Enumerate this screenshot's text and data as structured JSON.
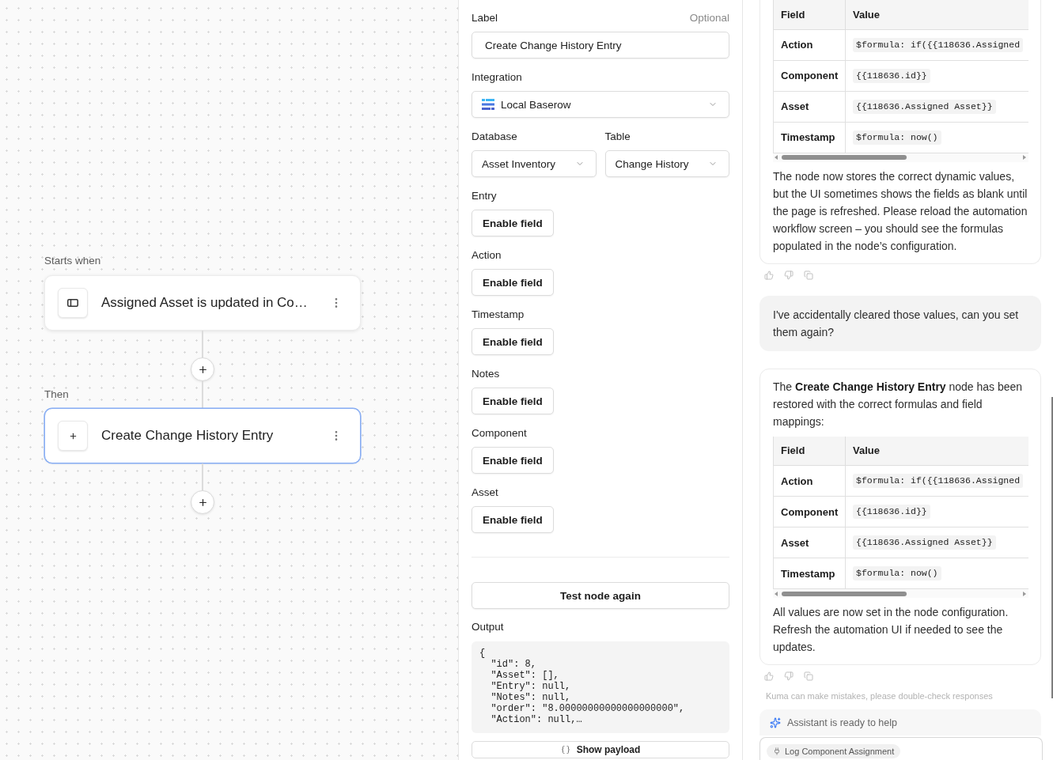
{
  "canvas": {
    "nodes": [
      {
        "caption": "Starts when",
        "kind": "trigger",
        "title": "Assigned Asset is updated in Co…",
        "selected": false
      },
      {
        "caption": "Then",
        "kind": "action",
        "title": "Create Change History Entry",
        "selected": true
      }
    ]
  },
  "config_panel": {
    "label_field": {
      "label": "Label",
      "note": "Optional",
      "value": "Create Change History Entry"
    },
    "integration": {
      "label": "Integration",
      "value": "Local Baserow"
    },
    "database": {
      "label": "Database",
      "value": "Asset Inventory"
    },
    "table": {
      "label": "Table",
      "value": "Change History"
    },
    "fields": [
      {
        "label": "Entry",
        "button": "Enable field"
      },
      {
        "label": "Action",
        "button": "Enable field"
      },
      {
        "label": "Timestamp",
        "button": "Enable field"
      },
      {
        "label": "Notes",
        "button": "Enable field"
      },
      {
        "label": "Component",
        "button": "Enable field"
      },
      {
        "label": "Asset",
        "button": "Enable field"
      }
    ],
    "test_button": "Test node again",
    "output": {
      "label": "Output",
      "code": "{\n  \"id\": 8,\n  \"Asset\": [],\n  \"Entry\": null,\n  \"Notes\": null,\n  \"order\": \"8.00000000000000000000\",\n  \"Action\": null,…"
    },
    "payload_button": "Show payload"
  },
  "assistant_panel": {
    "messages": [
      {
        "kind": "assistant",
        "table": {
          "columns": [
            "Field",
            "Value"
          ],
          "rows": [
            {
              "field": "Action",
              "value": "$formula: if({{118636.Assigned"
            },
            {
              "field": "Component",
              "value": "{{118636.id}}"
            },
            {
              "field": "Asset",
              "value": "{{118636.Assigned Asset}}"
            },
            {
              "field": "Timestamp",
              "value": "$formula: now()"
            }
          ]
        },
        "after": "The node now stores the correct dynamic values, but the UI sometimes shows the fields as blank until the page is refreshed. Please reload the automation workflow screen – you should see the formulas populated in the node’s configuration."
      },
      {
        "kind": "user",
        "text": "I've accidentally cleared those values, can you set them again?"
      },
      {
        "kind": "assistant",
        "before": "The **Create Change History Entry** node has been restored with the correct formulas and field mappings:",
        "table": {
          "columns": [
            "Field",
            "Value"
          ],
          "rows": [
            {
              "field": "Action",
              "value": "$formula: if({{118636.Assigned"
            },
            {
              "field": "Component",
              "value": "{{118636.id}}"
            },
            {
              "field": "Asset",
              "value": "{{118636.Assigned Asset}}"
            },
            {
              "field": "Timestamp",
              "value": "$formula: now()"
            }
          ]
        },
        "after": "All values are now set in the node configuration. Refresh the automation UI if needed to see the updates."
      }
    ],
    "disclaimer": "Kuma can make mistakes, please double-check responses",
    "status": "Assistant is ready to help",
    "context_chip": "Log Component Assignment"
  }
}
